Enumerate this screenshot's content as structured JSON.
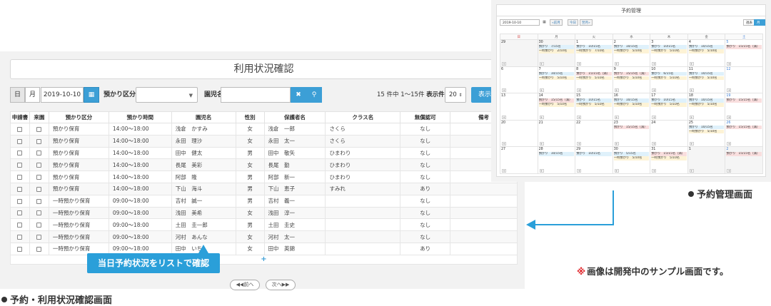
{
  "usage": {
    "title": "利用状況確認",
    "toolbar": {
      "day": "日",
      "month": "月",
      "date": "2019-10-10",
      "category_label": "預かり区分",
      "child_label": "園児名",
      "count_text": "15 件中 1～15件",
      "per_page_label": "表示件数",
      "per_page_value": "20",
      "show": "表示"
    },
    "columns": [
      "申請書",
      "来園",
      "預かり区分",
      "預かり時間",
      "園児名",
      "性別",
      "保護者名",
      "クラス名",
      "無償認可",
      "備考"
    ],
    "rows": [
      [
        "預かり保育",
        "14:00～18:00",
        "浅倉　かすみ",
        "女",
        "浅倉　一郎",
        "さくら",
        "なし"
      ],
      [
        "預かり保育",
        "14:00～18:00",
        "永田　理沙",
        "女",
        "永田　太一",
        "さくら",
        "なし"
      ],
      [
        "預かり保育",
        "14:00～18:00",
        "田中　健太",
        "男",
        "田中　敬矢",
        "ひまわり",
        "なし"
      ],
      [
        "預かり保育",
        "14:00～18:00",
        "長尾　美彩",
        "女",
        "長尾　勤",
        "ひまわり",
        "なし"
      ],
      [
        "預かり保育",
        "14:00～18:00",
        "阿部　隆",
        "男",
        "阿部　新一",
        "ひまわり",
        "なし"
      ],
      [
        "預かり保育",
        "14:00～18:00",
        "下山　海斗",
        "男",
        "下山　恵子",
        "すみれ",
        "あり"
      ],
      [
        "一時預かり保育",
        "09:00～18:00",
        "吉村　誠一",
        "男",
        "吉村　義一",
        "",
        "なし"
      ],
      [
        "一時預かり保育",
        "09:00～18:00",
        "浅田　美希",
        "女",
        "浅田　淳一",
        "",
        "なし"
      ],
      [
        "一時預かり保育",
        "09:00～18:00",
        "土田　圭一郎",
        "男",
        "土田　圭史",
        "",
        "なし"
      ],
      [
        "一時預かり保育",
        "09:00～18:00",
        "河村　あんな",
        "女",
        "河村　太一",
        "",
        "なし"
      ],
      [
        "一時預かり保育",
        "09:00～18:00",
        "田中　いち",
        "女",
        "田中　英錦",
        "",
        "あり"
      ]
    ],
    "add": "+",
    "prev": "前へ",
    "next": "次へ",
    "callout": "当日予約状況をリストで確認",
    "caption": "予約・利用状況確認画面"
  },
  "reservation": {
    "title": "予約管理",
    "date": "2019-10-10",
    "prev": "前月",
    "today": "今日",
    "next": "翌月",
    "view_week": "週表",
    "view_month": "月表",
    "weekdays": [
      "日",
      "月",
      "火",
      "水",
      "木",
      "金",
      "土"
    ],
    "caption": "予約管理画面",
    "days": [
      {
        "d": "29",
        "dim": true,
        "ev": []
      },
      {
        "d": "30",
        "dim": true,
        "ev": [
          [
            "預かり　7/15名",
            "b"
          ],
          [
            "一時預かり　2/10名",
            "y"
          ]
        ]
      },
      {
        "d": "1",
        "ev": [
          [
            "預かり　10/15名",
            "b"
          ],
          [
            "一時預かり　7/10名",
            "y"
          ]
        ]
      },
      {
        "d": "2",
        "ev": [
          [
            "預かり　10/15名",
            "b"
          ],
          [
            "一時預かり　5/10名",
            "y"
          ]
        ]
      },
      {
        "d": "3",
        "ev": [
          [
            "預かり　10/15名",
            "b"
          ],
          [
            "一時預かり　5/10名",
            "y"
          ]
        ]
      },
      {
        "d": "4",
        "ev": [
          [
            "預かり　10/15名",
            "b"
          ],
          [
            "一時預かり　5/10名",
            "y"
          ]
        ]
      },
      {
        "d": "5",
        "sat": true,
        "ev": [
          [
            "預かり　15/15名（満）",
            "r"
          ]
        ]
      },
      {
        "d": "6",
        "ev": []
      },
      {
        "d": "7",
        "ev": [
          [
            "預かり　10/15名",
            "b"
          ],
          [
            "一時預かり　5/10名",
            "y"
          ]
        ]
      },
      {
        "d": "8",
        "ev": [
          [
            "預かり　15/15名（満）",
            "r"
          ],
          [
            "一時預かり　5/10名",
            "y"
          ]
        ]
      },
      {
        "d": "9",
        "ev": [
          [
            "預かり　15/15名（満）",
            "r"
          ],
          [
            "一時預かり　5/10名",
            "y"
          ]
        ]
      },
      {
        "d": "10",
        "ev": [
          [
            "預かり　6/15名",
            "b"
          ],
          [
            "一時預かり　5/10名",
            "y"
          ]
        ]
      },
      {
        "d": "11",
        "ev": [
          [
            "預かり　10/15名",
            "b"
          ],
          [
            "一時預かり　5/10名",
            "y"
          ]
        ]
      },
      {
        "d": "12",
        "sat": true,
        "ev": []
      },
      {
        "d": "13",
        "ev": []
      },
      {
        "d": "14",
        "ev": [
          [
            "預かり　15/15名（満）",
            "r"
          ],
          [
            "一時預かり　5/10名",
            "y"
          ]
        ]
      },
      {
        "d": "15",
        "ev": [
          [
            "預かり　10/15名",
            "b"
          ],
          [
            "一時預かり　5/10名",
            "y"
          ]
        ]
      },
      {
        "d": "16",
        "ev": [
          [
            "預かり　10/15名",
            "b"
          ],
          [
            "一時預かり　5/10名",
            "y"
          ]
        ]
      },
      {
        "d": "17",
        "ev": [
          [
            "預かり　10/15名",
            "b"
          ],
          [
            "一時預かり　5/10名",
            "y"
          ]
        ]
      },
      {
        "d": "18",
        "ev": [
          [
            "預かり　10/15名",
            "b"
          ],
          [
            "一時預かり　5/10名",
            "y"
          ]
        ]
      },
      {
        "d": "19",
        "sat": true,
        "ev": [
          [
            "預かり　15/15名（満）",
            "r"
          ]
        ]
      },
      {
        "d": "20",
        "ev": []
      },
      {
        "d": "21",
        "ev": []
      },
      {
        "d": "22",
        "ev": []
      },
      {
        "d": "23",
        "ev": [
          [
            "預かり　15/15名（満）",
            "r"
          ]
        ]
      },
      {
        "d": "24",
        "ev": []
      },
      {
        "d": "25",
        "ev": [
          [
            "預かり　10/15名",
            "b"
          ],
          [
            "一時預かり　5/10名",
            "y"
          ]
        ]
      },
      {
        "d": "26",
        "sat": true,
        "ev": [
          [
            "預かり　15/15名（満）",
            "r"
          ]
        ]
      },
      {
        "d": "27",
        "ev": []
      },
      {
        "d": "28",
        "ev": [
          [
            "預かり　10/15名",
            "b"
          ]
        ]
      },
      {
        "d": "29",
        "ev": [
          [
            "預かり　10/15名",
            "b"
          ]
        ]
      },
      {
        "d": "30",
        "ev": [
          [
            "預かり　5/15名",
            "b"
          ],
          [
            "一時預かり　5/10名",
            "y"
          ]
        ]
      },
      {
        "d": "31",
        "ev": [
          [
            "預かり　15/15名（満）",
            "r"
          ],
          [
            "一時預かり　5/10名",
            "y"
          ]
        ]
      },
      {
        "d": "1",
        "dim": true,
        "ev": []
      },
      {
        "d": "2",
        "dim": true,
        "sat": true,
        "ev": [
          [
            "預かり　15/15名（満）",
            "r"
          ]
        ]
      }
    ]
  },
  "note": {
    "mark": "※",
    "text": "画像は開発中のサンプル画面です。"
  }
}
